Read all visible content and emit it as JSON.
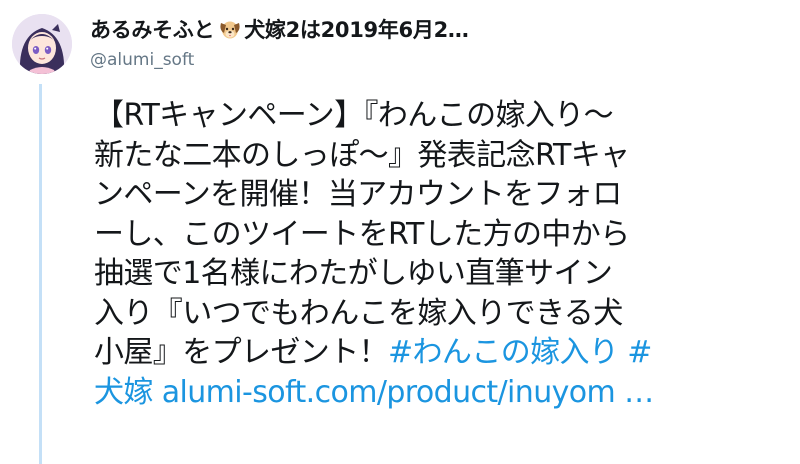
{
  "author": {
    "display_name": "あるみそふと",
    "name_suffix": "犬嫁2は2019年6月2…",
    "handle": "@alumi_soft",
    "emoji_icon": "dog-face-icon"
  },
  "tweet": {
    "lines": [
      {
        "text": "【RTキャンペーン】『わんこの嫁入り～"
      },
      {
        "text": "新たな二本のしっぽ～』発表記念RTキャ"
      },
      {
        "text": "ンペーンを開催！当アカウントをフォロ"
      },
      {
        "text": "ーし、このツイートをRTした方の中から"
      },
      {
        "text": "抽選で1名様にわたがしゆい直筆サイン"
      },
      {
        "text": "入り『いつでもわんこを嫁入りできる犬"
      },
      {
        "text": "小屋』をプレゼント！",
        "hashtag": "#わんこの嫁入り #"
      },
      {
        "hashtag_cont": "犬嫁",
        "link": "alumi-soft.com/product/inuyom …"
      }
    ]
  },
  "colors": {
    "link": "#1b95e0",
    "text": "#14171a",
    "secondary": "#657786",
    "thread_line": "#c4e0f7"
  }
}
